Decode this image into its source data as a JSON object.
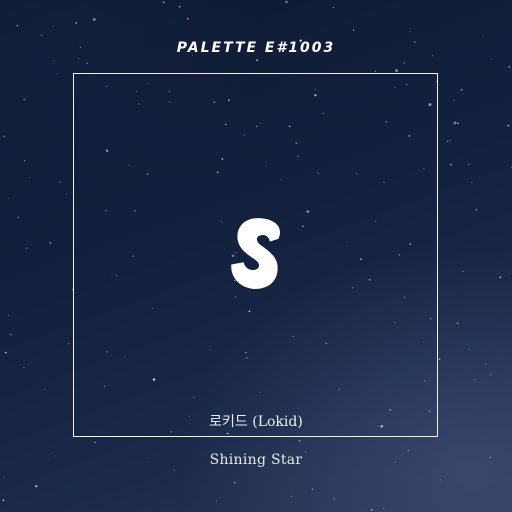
{
  "cover": {
    "series_title": "PALETTE E#1003",
    "logo_letter": "S",
    "artist": "로키드 (Lokid)",
    "track_title": "Shining Star"
  },
  "colors": {
    "background_dark": "#0f1a33",
    "background_light": "#2c3556",
    "frame": "#f2f2f2",
    "text": "#ffffff"
  }
}
